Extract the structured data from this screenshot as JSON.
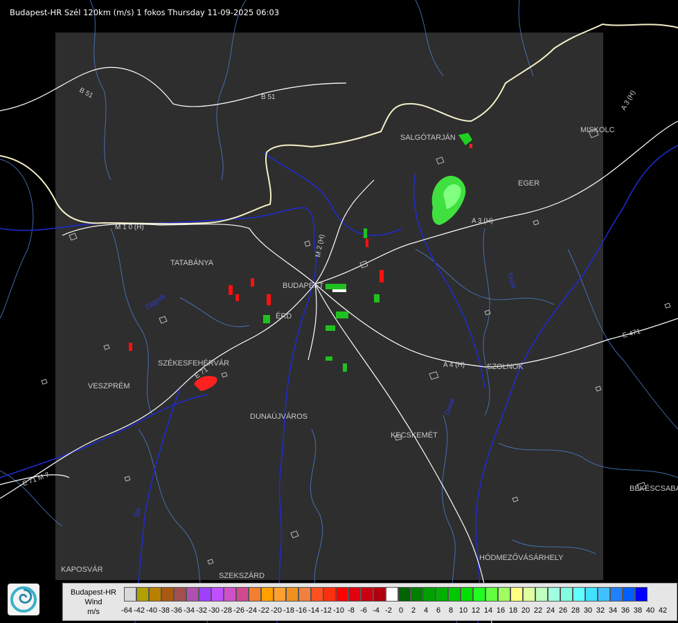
{
  "header": {
    "title": "Budapest-HR Szél 120km (m/s) 1 fokos Thursday 11-09-2025 06:03"
  },
  "map": {
    "places": [
      "SALGÓTARJÁN",
      "MISKOLC",
      "EGER",
      "TATABÁNYA",
      "BUDAPEST",
      "ÉRD",
      "SZÉKESFEHÉRVÁR",
      "VESZPRÉM",
      "DUNAÚJVÁROS",
      "KECSKEMÉT",
      "SZOLNOK",
      "BÉKÉSCSABA",
      "HÓDMEZŐVÁSÁRHELY",
      "KAPOSVÁR",
      "SZEKSZÁRD"
    ],
    "roads": [
      "B 51",
      "B 51",
      "M 1 0 (H)",
      "A 3 (H)",
      "A 3 (H)",
      "M 2 (H)",
      "A 4 (H)",
      "E 71",
      "E 71 M 7",
      "E 471"
    ],
    "rivers": [
      "Duna",
      "Tisza",
      "Zagyva",
      "Sió"
    ],
    "colors": {
      "background": "#000000",
      "radar_area": "#2e2e2e",
      "river": "#1f2ad0",
      "road": "#ffffff",
      "county_border": "#4a7bc8",
      "country_border": "#ffffff"
    }
  },
  "legend": {
    "station": "Budapest-HR",
    "product": "Wind",
    "unit": "m/s",
    "tick_values": [
      "-64",
      "-42",
      "-40",
      "-38",
      "-36",
      "-34",
      "-32",
      "-30",
      "-28",
      "-26",
      "-24",
      "-22",
      "-20",
      "-18",
      "-16",
      "-14",
      "-12",
      "-10",
      "-8",
      "-6",
      "-4",
      "-2",
      "0",
      "2",
      "4",
      "6",
      "8",
      "10",
      "12",
      "14",
      "16",
      "18",
      "20",
      "22",
      "24",
      "26",
      "28",
      "30",
      "32",
      "34",
      "36",
      "38",
      "40",
      "42"
    ],
    "colors": [
      "#d9d9d9",
      "#b0a000",
      "#b88000",
      "#a85a10",
      "#a05050",
      "#b050b0",
      "#a040ff",
      "#c050ff",
      "#d050c8",
      "#d04890",
      "#f08030",
      "#ffa000",
      "#ffa030",
      "#f09020",
      "#f08040",
      "#ff5020",
      "#ff3010",
      "#ff0000",
      "#e00010",
      "#c80010",
      "#b00010",
      "#ffffff",
      "#006400",
      "#008000",
      "#00a000",
      "#00b000",
      "#00c800",
      "#00e000",
      "#20ff20",
      "#60ff40",
      "#a0ff60",
      "#ffff80",
      "#e0ffa0",
      "#c0ffc0",
      "#a0ffe0",
      "#80ffe0",
      "#60ffff",
      "#40e0ff",
      "#40c0ff",
      "#2080ff",
      "#0060ff",
      "#0000ff"
    ],
    "logo_icon": "radar-swirl-logo"
  }
}
